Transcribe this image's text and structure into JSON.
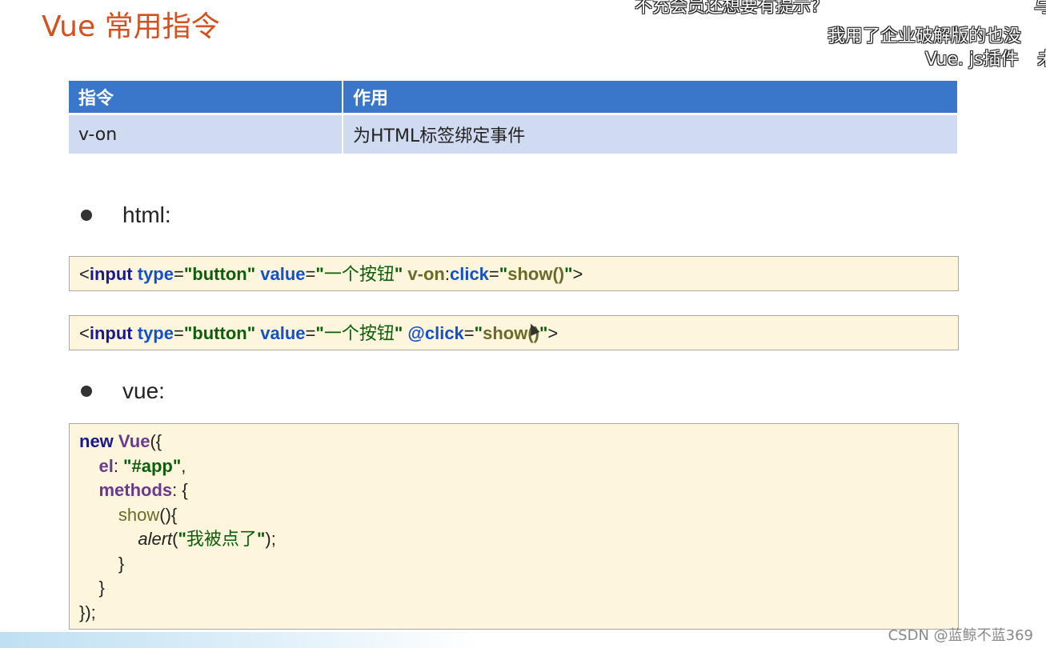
{
  "title": "Vue 常用指令",
  "danmaku": {
    "line1": "不充会员还想要有提示？",
    "line1_right": "与",
    "line2": "我用了企业破解版的也没",
    "line3": "Vue. js插件",
    "line3_right": "未"
  },
  "table": {
    "headers": [
      "指令",
      "作用"
    ],
    "rows": [
      [
        "v-on",
        "为HTML标签绑定事件"
      ]
    ]
  },
  "bullets": [
    "html:",
    "vue:"
  ],
  "code1": {
    "lt": "<",
    "input": "input",
    "type_attr": "type",
    "eq1": "=",
    "type_val": "\"button\"",
    "value_attr": "value",
    "eq2": "=",
    "value_q1": "\"",
    "value_text": "一个按钮",
    "value_q2": "\"",
    "von": "v-on",
    "colon": ":",
    "click": "click",
    "eq3": "=",
    "q3": "\"",
    "show": "show()",
    "q4": "\"",
    "gt": ">"
  },
  "code2": {
    "lt": "<",
    "input": "input",
    "type_attr": "type",
    "eq1": "=",
    "type_val": "\"button\"",
    "value_attr": "value",
    "eq2": "=",
    "value_q1": "\"",
    "value_text": "一个按钮",
    "value_q2": "\"",
    "atclick": "@click",
    "eq3": "=",
    "q3": "\"",
    "show": "show()",
    "q4": "\"",
    "gt": ">"
  },
  "code3": {
    "new": "new",
    "vue": "Vue",
    "open": "({",
    "el": "el",
    "el_colon": ": ",
    "el_val": "\"#app\"",
    "el_comma": ",",
    "methods": "methods",
    "methods_open": ": {",
    "show": "show",
    "show_paren": "(){",
    "alert": "alert",
    "alert_open": "(",
    "alert_q1": "\"",
    "alert_text": "我被点了",
    "alert_q2": "\"",
    "alert_close": ");",
    "close_inner": "}",
    "close_methods": "}",
    "close_all": "});"
  },
  "watermark": "CSDN @蓝鲸不蓝369"
}
